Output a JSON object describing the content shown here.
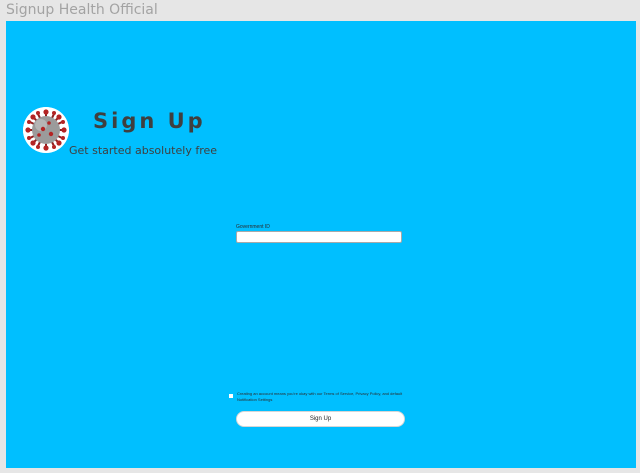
{
  "window": {
    "title": "Signup Health Official"
  },
  "header": {
    "logo_icon": "coronavirus-icon",
    "title": "Sign Up",
    "subtitle": "Get started absolutely free"
  },
  "form": {
    "government_id_label": "Government ID",
    "government_id_value": "",
    "terms_checkbox_checked": false,
    "terms_text": "Creating an account means you're okay with our Terms of Service, Privacy Policy, and default Notification Settings",
    "submit_label": "Sign Up"
  },
  "colors": {
    "background": "#00bfff",
    "frame": "#e6e6e6",
    "text": "#3f3f3f",
    "button": "#ffffff"
  }
}
